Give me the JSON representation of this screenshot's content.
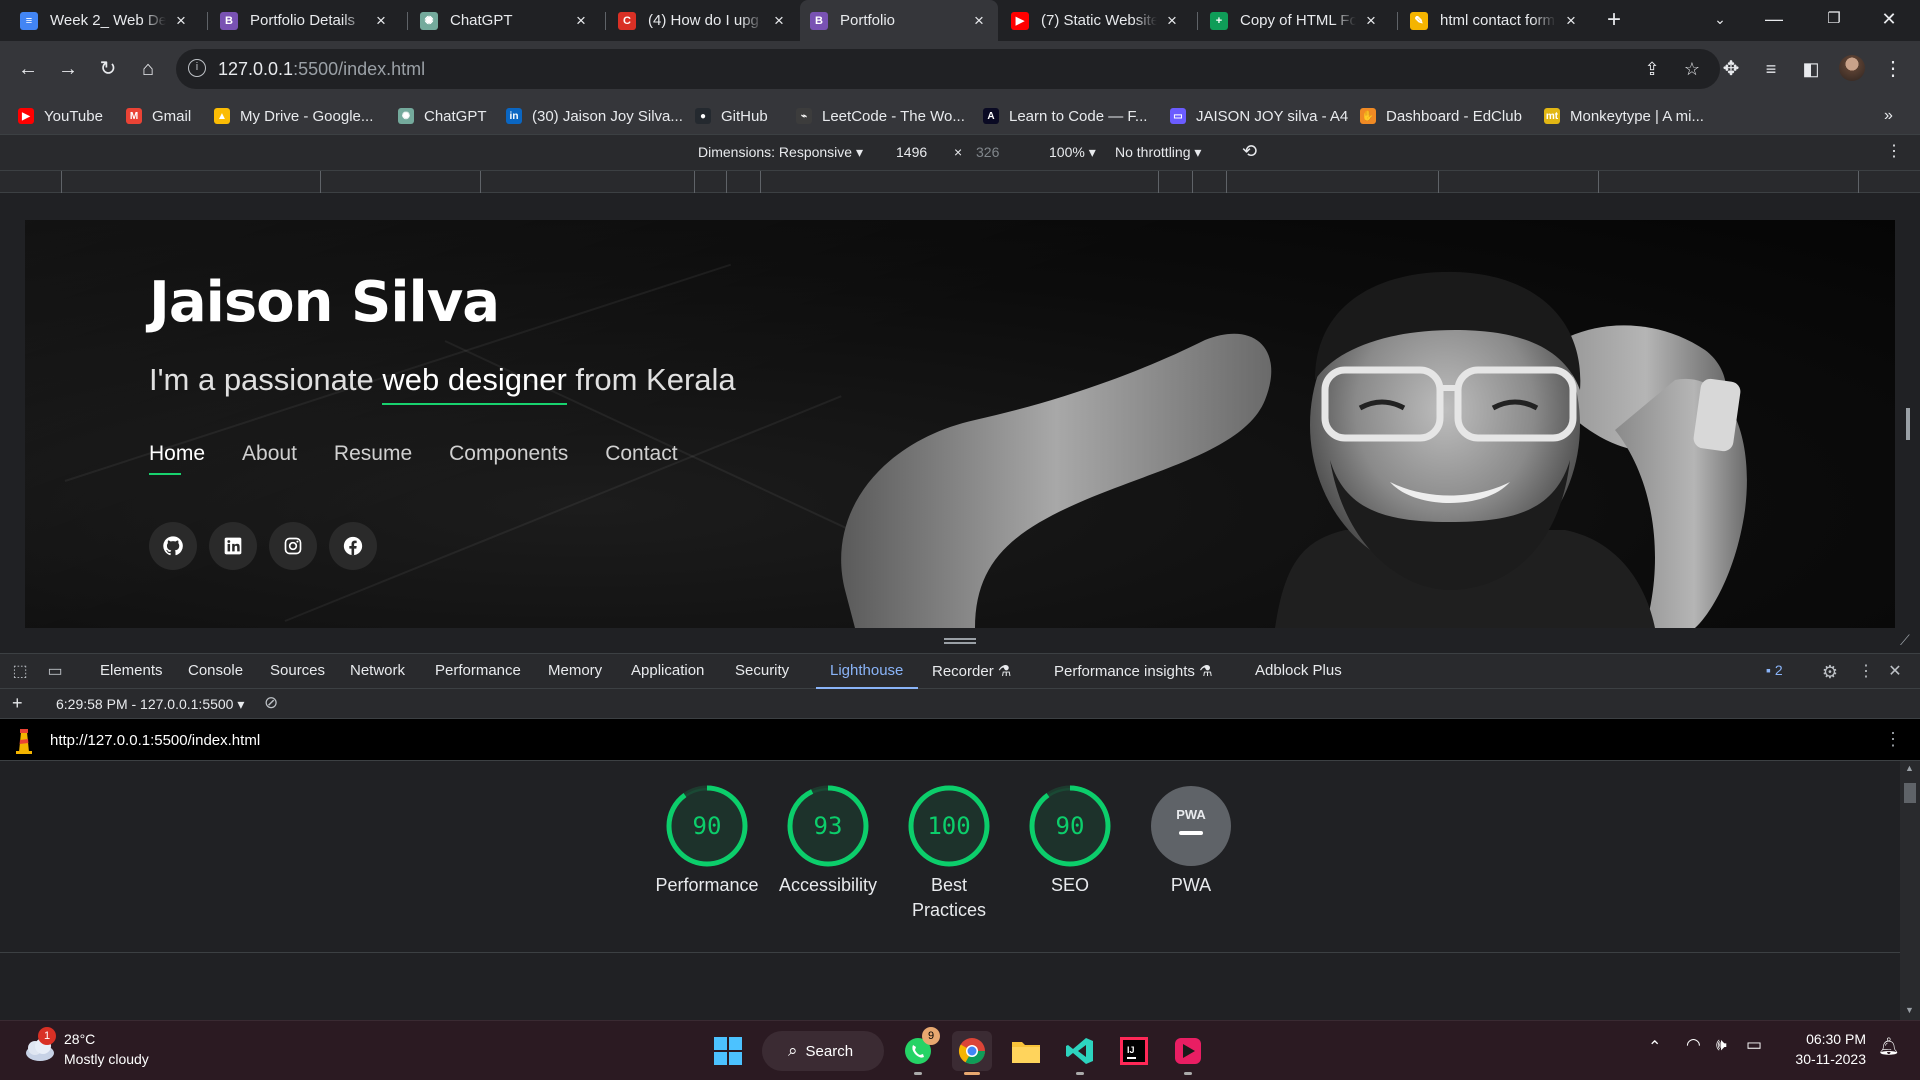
{
  "browser": {
    "tabs": [
      {
        "title": "Week 2_ Web De",
        "icon": "docs-icon",
        "color": "#4285f4",
        "glyph": "≡"
      },
      {
        "title": "Portfolio Details",
        "icon": "bootstrap-icon",
        "color": "#7952b3",
        "glyph": "B"
      },
      {
        "title": "ChatGPT",
        "icon": "chatgpt-icon",
        "color": "#74aa9c",
        "glyph": "✺"
      },
      {
        "title": "(4) How do I upg",
        "icon": "quora-icon",
        "color": "#d93025",
        "glyph": "C"
      },
      {
        "title": "Portfolio",
        "icon": "bootstrap-icon",
        "color": "#7952b3",
        "glyph": "B",
        "active": true
      },
      {
        "title": "(7) Static Website",
        "icon": "youtube-icon",
        "color": "#ff0000",
        "glyph": "▶"
      },
      {
        "title": "Copy of HTML Fo",
        "icon": "sheets-icon",
        "color": "#0f9d58",
        "glyph": "+"
      },
      {
        "title": "html contact form",
        "icon": "colorful-icon",
        "color": "#f4b400",
        "glyph": "✎"
      }
    ],
    "address": {
      "host": "127.0.0.1",
      "rest": ":5500/index.html"
    },
    "bookmarks": [
      {
        "label": "YouTube",
        "icon": "youtube-icon",
        "color": "#ff0000",
        "glyph": "▶"
      },
      {
        "label": "Gmail",
        "icon": "gmail-icon",
        "color": "#ea4335",
        "glyph": "M"
      },
      {
        "label": "My Drive - Google...",
        "icon": "drive-icon",
        "color": "#fbbc04",
        "glyph": "▲"
      },
      {
        "label": "ChatGPT",
        "icon": "chatgpt-icon",
        "color": "#74aa9c",
        "glyph": "✺"
      },
      {
        "label": "(30) Jaison Joy Silva...",
        "icon": "linkedin-icon",
        "color": "#0a66c2",
        "glyph": "in"
      },
      {
        "label": "GitHub",
        "icon": "github-icon",
        "color": "#24292f",
        "glyph": "●"
      },
      {
        "label": "LeetCode - The Wo...",
        "icon": "leetcode-icon",
        "color": "#3c3c3c",
        "glyph": "⌁"
      },
      {
        "label": "Learn to Code — F...",
        "icon": "freecodecamp-icon",
        "color": "#0a0a23",
        "glyph": "A"
      },
      {
        "label": "JAISON JOY silva - A4",
        "icon": "canva-icon",
        "color": "#6b5cff",
        "glyph": "▭"
      },
      {
        "label": "Dashboard - EdClub",
        "icon": "edclub-icon",
        "color": "#f08a24",
        "glyph": "✋"
      },
      {
        "label": "Monkeytype | A mi...",
        "icon": "monkeytype-icon",
        "color": "#e2b714",
        "glyph": "mt"
      }
    ]
  },
  "device_toolbar": {
    "dimensions": "Dimensions: Responsive",
    "width": "1496",
    "times": "×",
    "height": "326",
    "zoom": "100%",
    "throttling": "No throttling"
  },
  "hero": {
    "name": "Jaison Silva",
    "tagline_prefix": "I'm a passionate ",
    "tagline_typed": "web designer",
    "tagline_suffix": " from Kerala",
    "nav": [
      "Home",
      "About",
      "Resume",
      "Components",
      "Contact"
    ],
    "social": [
      "github-icon",
      "linkedin-icon",
      "instagram-icon",
      "facebook-icon"
    ],
    "accent": "#18d26e"
  },
  "devtools": {
    "tabs": [
      "Elements",
      "Console",
      "Sources",
      "Network",
      "Performance",
      "Memory",
      "Application",
      "Security",
      "Lighthouse",
      "Recorder",
      "Performance insights",
      "Adblock Plus"
    ],
    "active_tab": "Lighthouse",
    "issues_count": "2",
    "report_time": "6:29:58 PM - 127.0.0.1:5500",
    "report_url": "http://127.0.0.1:5500/index.html"
  },
  "lighthouse": {
    "scores": [
      {
        "label": "Performance",
        "value": "90",
        "score": 0.9
      },
      {
        "label": "Accessibility",
        "value": "93",
        "score": 0.93
      },
      {
        "label": "Best Practices",
        "value": "100",
        "score": 1.0
      },
      {
        "label": "SEO",
        "value": "90",
        "score": 0.9
      }
    ],
    "pwa_label": "PWA",
    "pwa_badge": "PWA",
    "pass_color": "#0cce6b"
  },
  "taskbar": {
    "weather_temp": "28°C",
    "weather_desc": "Mostly cloudy",
    "weather_badge": "1",
    "search_label": "Search",
    "whatsapp_badge": "9",
    "time": "06:30 PM",
    "date": "30-11-2023"
  }
}
